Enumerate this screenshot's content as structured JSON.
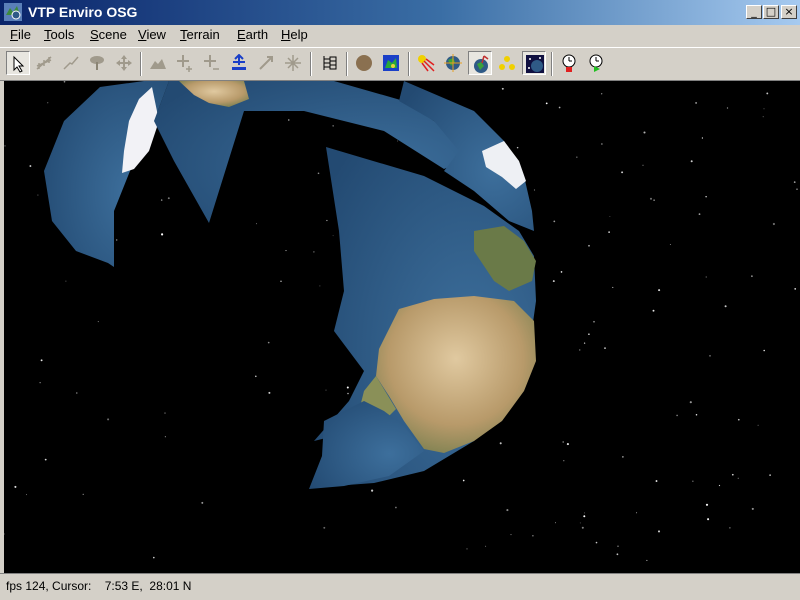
{
  "window": {
    "title": "VTP Enviro OSG"
  },
  "menu": [
    {
      "key": "F",
      "rest": "ile"
    },
    {
      "key": "T",
      "rest": "ools"
    },
    {
      "key": "S",
      "rest": "cene"
    },
    {
      "key": "V",
      "rest": "iew"
    },
    {
      "key": "T",
      "rest": "errain"
    },
    {
      "key": "E",
      "rest": "arth"
    },
    {
      "key": "H",
      "rest": "elp"
    }
  ],
  "toolbar": {
    "icons": [
      "select-arrow-icon",
      "fence-icon",
      "route-icon",
      "plant-icon",
      "navigate-move-icon",
      "terrain-icon",
      "zoom-in-icon",
      "zoom-out-icon",
      "snap-ground-icon",
      "fence-link-icon",
      "structures-icon",
      "scene-graph-icon",
      "sphere-icon",
      "terrain-map-icon",
      "sun-lighting-icon",
      "globe-icon",
      "earth-view-icon",
      "points-icon",
      "stars-icon",
      "record-icon",
      "play-icon"
    ],
    "pressed": [
      "select-arrow-icon",
      "earth-view-icon",
      "stars-icon"
    ]
  },
  "status": {
    "text": "fps 124, Cursor:    7:53 E,  28:01 N"
  },
  "colors": {
    "title_start": "#0a246a",
    "title_end": "#a6caf0",
    "chrome": "#d4d0c8",
    "space": "#000000",
    "ocean": "#2f5a86"
  }
}
